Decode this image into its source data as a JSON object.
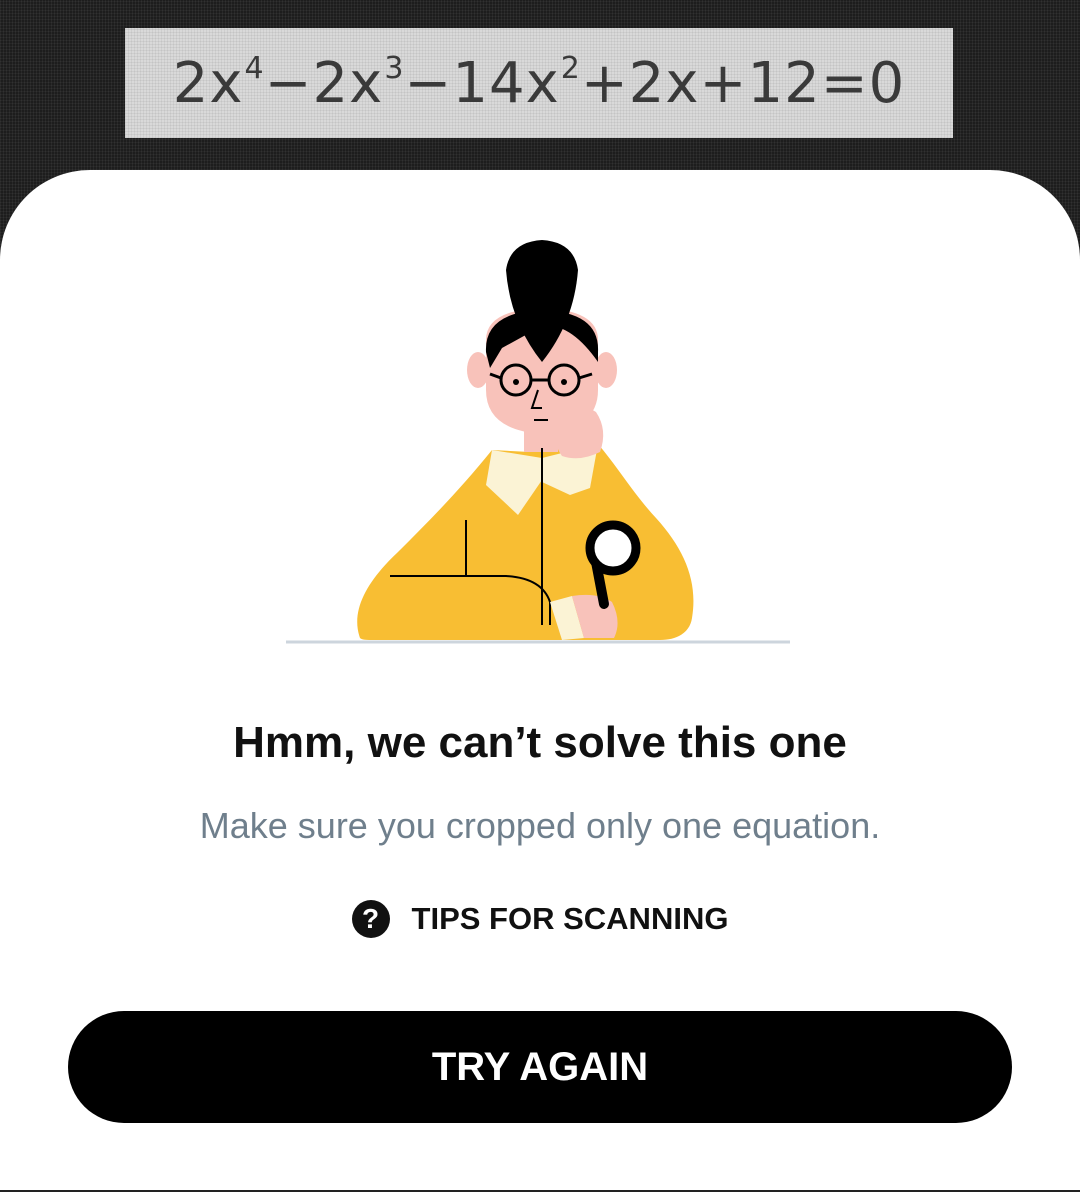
{
  "scan": {
    "equation_parts": [
      {
        "base": "2x",
        "sup": "4"
      },
      {
        "base": "−2x",
        "sup": "3"
      },
      {
        "base": "−14x",
        "sup": "2"
      },
      {
        "base": "+2x+12=0",
        "sup": ""
      }
    ]
  },
  "dialog": {
    "illustration_icon": "thinking-person-with-magnifier-icon",
    "title": "Hmm, we can’t solve this one",
    "subtitle": "Make sure you cropped only one equation.",
    "tips": {
      "icon": "question-circle-icon",
      "glyph": "?",
      "label": "TIPS FOR SCANNING"
    },
    "primary_button": "TRY AGAIN"
  },
  "colors": {
    "shirt": "#F8BE33",
    "skin": "#F8C2BA",
    "hair": "#000000",
    "collar": "#FBF3D5",
    "subtitle_text": "#6F7F8C",
    "button_bg": "#000000"
  }
}
